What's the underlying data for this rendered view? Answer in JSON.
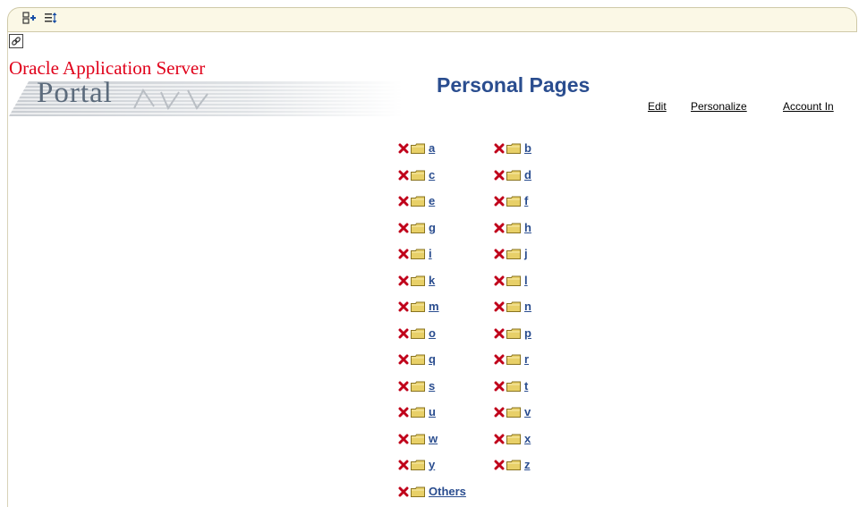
{
  "toolbar": {
    "icons": [
      "add-portlet-icon",
      "reorder-icon"
    ]
  },
  "link_icon": "link-icon",
  "brand": {
    "oracle_text": "Oracle Application Server",
    "portal_text": "Portal"
  },
  "page": {
    "title": "Personal Pages"
  },
  "nav": {
    "edit": "Edit",
    "personalize": "Personalize",
    "account": "Account In"
  },
  "folders": [
    [
      "a",
      "b"
    ],
    [
      "c",
      "d"
    ],
    [
      "e",
      "f"
    ],
    [
      "g",
      "h"
    ],
    [
      "i",
      "j"
    ],
    [
      "k",
      "l"
    ],
    [
      "m",
      "n"
    ],
    [
      "o",
      "p"
    ],
    [
      "q",
      "r"
    ],
    [
      "s",
      "t"
    ],
    [
      "u",
      "v"
    ],
    [
      "w",
      "x"
    ],
    [
      "y",
      "z"
    ],
    [
      "Others"
    ]
  ],
  "colors": {
    "delete_icon": "#c0001a",
    "folder": "#e8d068",
    "link": "#2a4d8f",
    "brand_red": "#e0001a"
  }
}
